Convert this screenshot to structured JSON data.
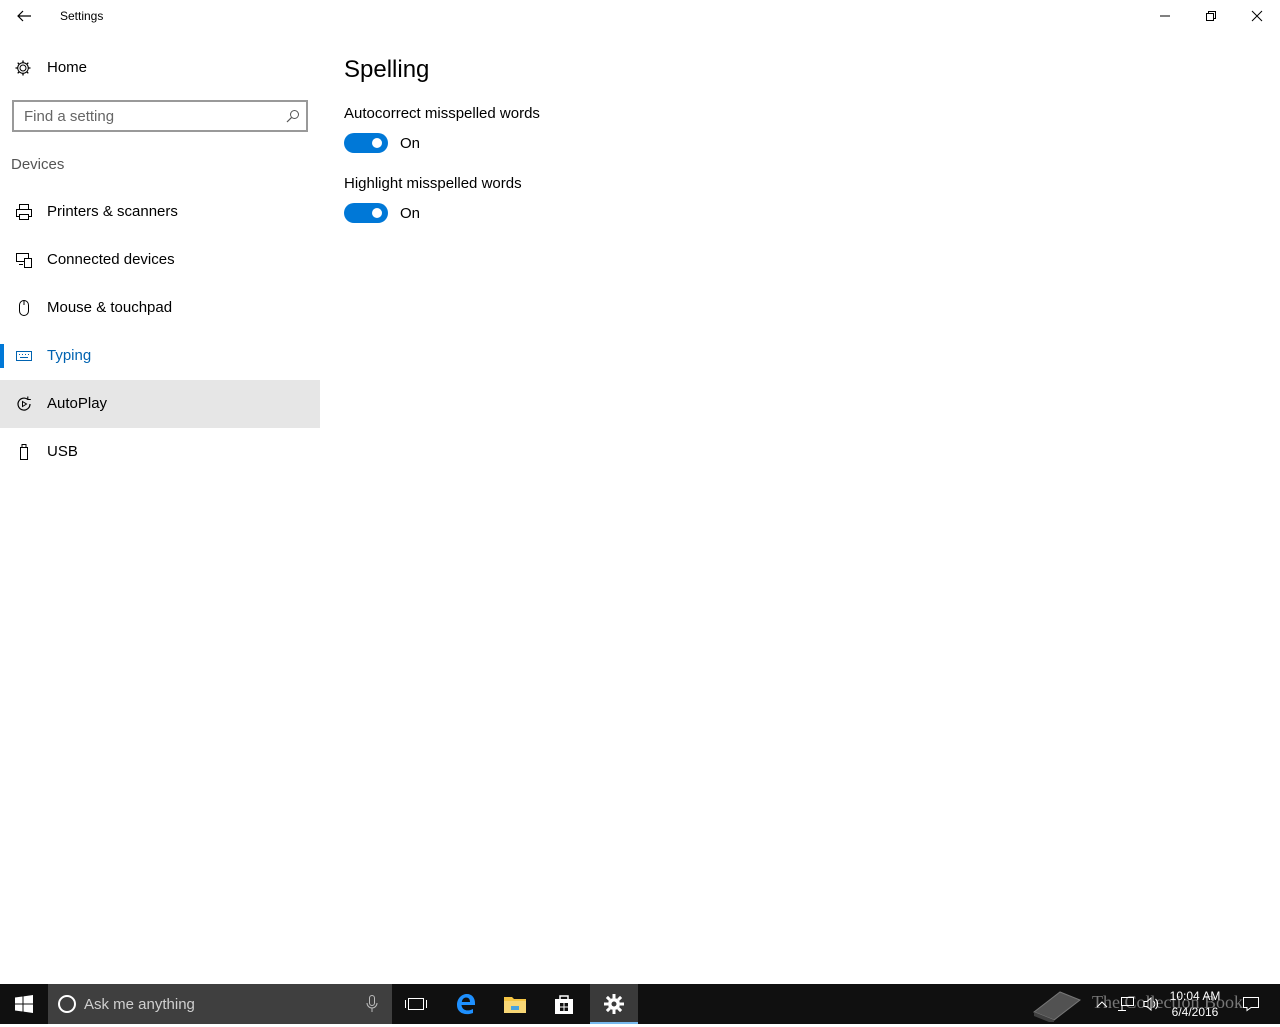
{
  "window": {
    "title": "Settings"
  },
  "sidebar": {
    "home_label": "Home",
    "search_placeholder": "Find a setting",
    "section_label": "Devices",
    "items": [
      {
        "label": "Printers & scanners",
        "icon": "printer-icon"
      },
      {
        "label": "Connected devices",
        "icon": "connected-devices-icon"
      },
      {
        "label": "Mouse & touchpad",
        "icon": "mouse-icon"
      },
      {
        "label": "Typing",
        "icon": "keyboard-icon",
        "state": "selected"
      },
      {
        "label": "AutoPlay",
        "icon": "autoplay-icon",
        "state": "hovered"
      },
      {
        "label": "USB",
        "icon": "usb-icon"
      }
    ]
  },
  "main": {
    "title": "Spelling",
    "settings": [
      {
        "label": "Autocorrect misspelled words",
        "state": "On",
        "enabled": true
      },
      {
        "label": "Highlight misspelled words",
        "state": "On",
        "enabled": true
      }
    ]
  },
  "taskbar": {
    "search_placeholder": "Ask me anything",
    "pinned": [
      "task-view-icon",
      "edge-icon",
      "file-explorer-icon",
      "store-icon",
      "settings-icon"
    ],
    "active": "settings-icon",
    "time": "10:04 AM",
    "date": "6/4/2016",
    "watermark": "The Collection Book"
  },
  "colors": {
    "accent": "#0078d7",
    "accent_text": "#0063b1",
    "hover_bg": "#e6e6e6",
    "taskbar": "#101010",
    "cortana_box": "#3f3f3f"
  }
}
